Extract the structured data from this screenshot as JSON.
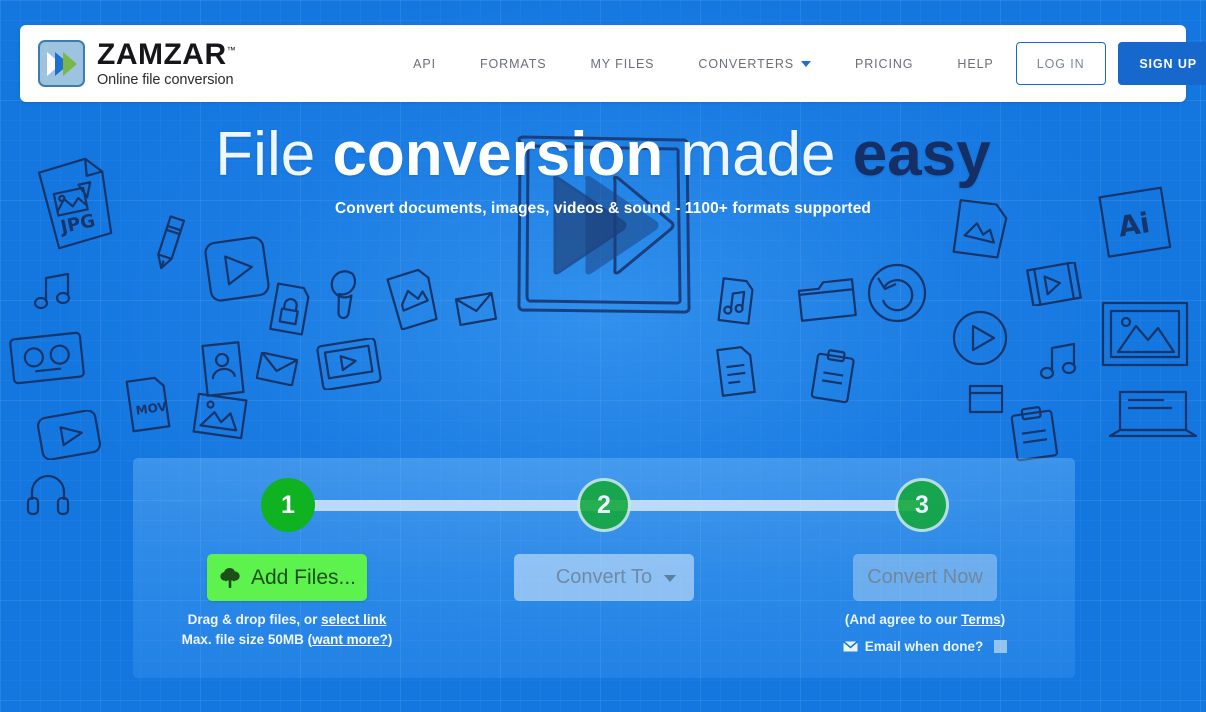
{
  "header": {
    "logo": {
      "name": "ZAMZAR",
      "tm": "™",
      "tagline": "Online file conversion",
      "icon": "zamzar-fast-forward-logo"
    },
    "nav": [
      {
        "label": "API",
        "name": "nav-item-api",
        "caret": false
      },
      {
        "label": "FORMATS",
        "name": "nav-item-formats",
        "caret": false
      },
      {
        "label": "MY FILES",
        "name": "nav-item-my-files",
        "caret": false
      },
      {
        "label": "CONVERTERS",
        "name": "nav-item-converters",
        "caret": true
      },
      {
        "label": "PRICING",
        "name": "nav-item-pricing",
        "caret": false
      },
      {
        "label": "HELP",
        "name": "nav-item-help",
        "caret": false
      }
    ],
    "login_label": "LOG IN",
    "signup_label": "SIGN UP"
  },
  "hero": {
    "headline": {
      "part1": "File ",
      "part2": "conversion ",
      "part3": "made ",
      "part4": "easy"
    },
    "subheadline": "Convert documents, images, videos & sound - 1100+ formats supported",
    "illustration": "sketched-fast-forward-box"
  },
  "converter": {
    "steps": [
      {
        "number": "1",
        "name": "step-1",
        "state": "active"
      },
      {
        "number": "2",
        "name": "step-2",
        "state": "inactive"
      },
      {
        "number": "3",
        "name": "step-3",
        "state": "inactive"
      }
    ],
    "add_files": {
      "label": "Add Files...",
      "icon": "cloud-upload-icon",
      "hint_prefix": "Drag & drop files, or ",
      "hint_link": "select link",
      "size_prefix": "Max. file size 50MB (",
      "size_link": "want more?",
      "size_suffix": ")"
    },
    "convert_to": {
      "label": "Convert To",
      "icon": "chevron-down-icon"
    },
    "convert_now": {
      "label": "Convert Now",
      "terms_prefix": "(And agree to our ",
      "terms_link": "Terms",
      "terms_suffix": ")",
      "email_icon": "envelope-icon",
      "email_label": "Email when done?",
      "email_checked": false
    }
  },
  "colors": {
    "page_blue": "#1477e0",
    "brand_blue": "#1668cc",
    "accent_green": "#0fb321",
    "add_files_green": "#5ef24e",
    "headline_accent": "#142f66",
    "nav_text": "#6a6f78"
  }
}
